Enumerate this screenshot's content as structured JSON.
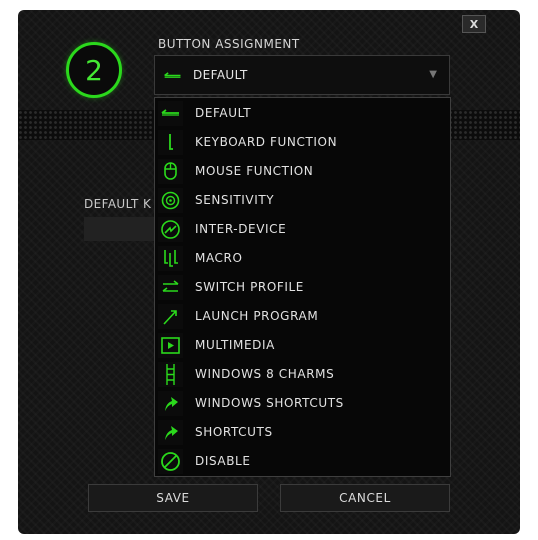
{
  "colors": {
    "accent": "#2bd91c",
    "background": "#141414",
    "text": "#e2e2e2"
  },
  "dialog": {
    "close_label": "X",
    "button_number": "2"
  },
  "assignment": {
    "section_label": "BUTTON ASSIGNMENT",
    "selected_value": "DEFAULT",
    "selected_icon": "default-arrow-icon",
    "arrow": "▼"
  },
  "background_labels": {
    "default_k": "DEFAULT K"
  },
  "menu": {
    "items": [
      {
        "label": "DEFAULT",
        "icon": "default-arrow-icon"
      },
      {
        "label": "KEYBOARD FUNCTION",
        "icon": "keyboard-key-icon"
      },
      {
        "label": "MOUSE FUNCTION",
        "icon": "mouse-icon"
      },
      {
        "label": "SENSITIVITY",
        "icon": "sensitivity-target-icon"
      },
      {
        "label": "INTER-DEVICE",
        "icon": "inter-device-icon"
      },
      {
        "label": "MACRO",
        "icon": "macro-icon"
      },
      {
        "label": "SWITCH PROFILE",
        "icon": "switch-arrows-icon"
      },
      {
        "label": "LAUNCH PROGRAM",
        "icon": "launch-arrow-icon"
      },
      {
        "label": "MULTIMEDIA",
        "icon": "play-icon"
      },
      {
        "label": "WINDOWS 8 CHARMS",
        "icon": "charms-icon"
      },
      {
        "label": "WINDOWS SHORTCUTS",
        "icon": "shortcut-arrow-icon"
      },
      {
        "label": "SHORTCUTS",
        "icon": "shortcut-arrow-icon"
      },
      {
        "label": "DISABLE",
        "icon": "disable-icon"
      }
    ]
  },
  "footer": {
    "save_label": "SAVE",
    "cancel_label": "CANCEL"
  }
}
